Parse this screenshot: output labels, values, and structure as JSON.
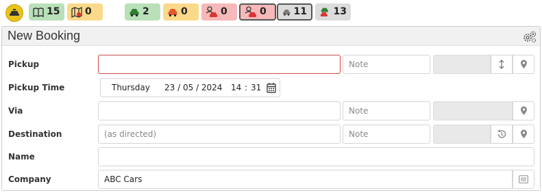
{
  "status_bar": {
    "chips": [
      {
        "icon": "book-icon",
        "value": "15",
        "color": "green"
      },
      {
        "icon": "map-icon",
        "value": "0",
        "color": "yellow"
      },
      {
        "icon": "car-icon",
        "value": "2",
        "color": "green"
      },
      {
        "icon": "car-icon",
        "value": "0",
        "color": "yellow"
      },
      {
        "icon": "driver-car-icon",
        "value": "0",
        "color": "red"
      },
      {
        "icon": "driver-car-icon",
        "value": "0",
        "color": "red",
        "selected": true
      },
      {
        "icon": "car-icon",
        "value": "11",
        "color": "grey"
      },
      {
        "icon": "car-stack-icon",
        "value": "13",
        "color": "grey"
      }
    ]
  },
  "panel": {
    "title": "New Booking"
  },
  "form": {
    "pickup": {
      "label": "Pickup",
      "value": "",
      "note_placeholder": "Note"
    },
    "pickup_time": {
      "label": "Pickup Time",
      "day": "Thursday",
      "date": "23 / 05 / 2024",
      "hour": "14",
      "sep": ":",
      "minute": "31"
    },
    "via": {
      "label": "Via",
      "value": "",
      "note_placeholder": "Note"
    },
    "destination": {
      "label": "Destination",
      "placeholder": "(as directed)",
      "note_placeholder": "Note"
    },
    "name": {
      "label": "Name",
      "value": ""
    },
    "company": {
      "label": "Company",
      "value": "ABC Cars"
    }
  },
  "colors": {
    "green": "#b9e0b9",
    "yellow": "#fbd98a",
    "red": "#f6b8b8",
    "grey": "#dcdcdc",
    "error_border": "#c94a4a"
  }
}
